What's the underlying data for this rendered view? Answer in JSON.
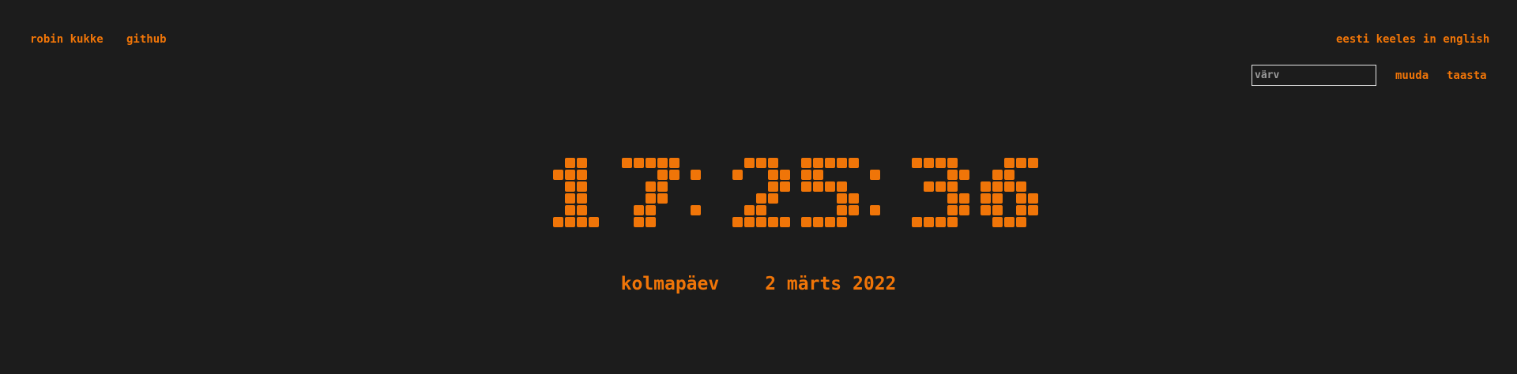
{
  "header": {
    "author": "robin kukke",
    "github": "github",
    "lang_et": "eesti keeles",
    "lang_en": "in english"
  },
  "color_controls": {
    "placeholder": "värv",
    "change_label": "muuda",
    "reset_label": "taasta"
  },
  "clock": {
    "time": "17:25:36"
  },
  "date": {
    "weekday": "kolmapäev",
    "full": "2 märts 2022"
  },
  "colors": {
    "background": "#1c1c1c",
    "accent": "#f07508",
    "input_border": "#e6e6e6"
  }
}
